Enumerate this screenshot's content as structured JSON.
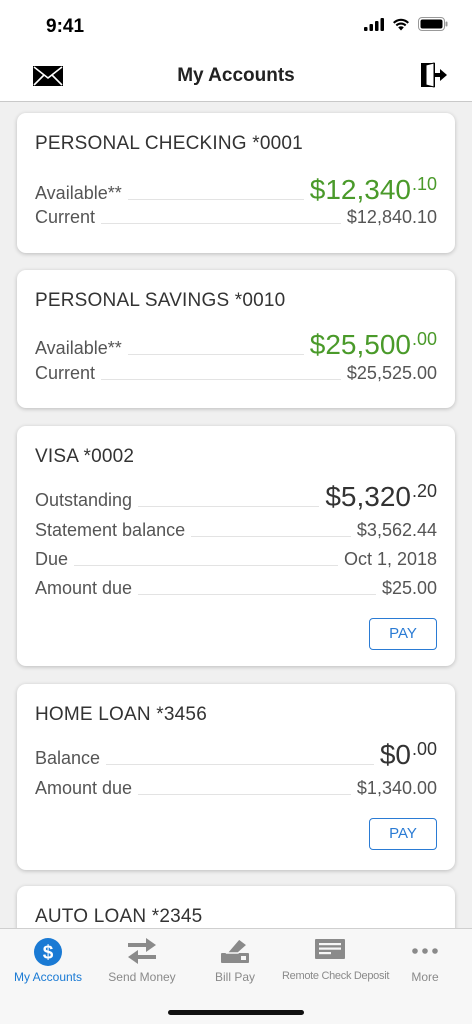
{
  "status_bar": {
    "time": "9:41"
  },
  "header": {
    "title": "My Accounts"
  },
  "accounts": [
    {
      "name": "PERSONAL CHECKING *0001",
      "rows": [
        {
          "label": "Available**",
          "value_main": "$12,340",
          "value_cents": ".10",
          "big": true,
          "color": "#4a9a2a"
        },
        {
          "label": "Current",
          "value": "$12,840.10"
        }
      ]
    },
    {
      "name": "PERSONAL SAVINGS *0010",
      "rows": [
        {
          "label": "Available**",
          "value_main": "$25,500",
          "value_cents": ".00",
          "big": true,
          "color": "#4a9a2a"
        },
        {
          "label": "Current",
          "value": "$25,525.00"
        }
      ]
    },
    {
      "name": "VISA *0002",
      "rows": [
        {
          "label": "Outstanding",
          "value_main": "$5,320",
          "value_cents": ".20",
          "big": true
        },
        {
          "label": "Statement balance",
          "value": "$3,562.44"
        },
        {
          "label": "Due",
          "value": "Oct 1, 2018"
        },
        {
          "label": "Amount due",
          "value": "$25.00"
        }
      ],
      "pay_label": "PAY"
    },
    {
      "name": "HOME LOAN *3456",
      "rows": [
        {
          "label": "Balance",
          "value_main": "$0",
          "value_cents": ".00",
          "big": true
        },
        {
          "label": "Amount due",
          "value": "$1,340.00"
        }
      ],
      "pay_label": "PAY"
    },
    {
      "name": "AUTO LOAN *2345"
    }
  ],
  "tabs": [
    {
      "label": "My Accounts",
      "icon": "dollar-circle-icon",
      "active": true
    },
    {
      "label": "Send Money",
      "icon": "transfer-arrows-icon"
    },
    {
      "label": "Bill Pay",
      "icon": "bill-pay-icon"
    },
    {
      "label": "Remote Check Deposit",
      "icon": "check-deposit-icon"
    },
    {
      "label": "More",
      "icon": "more-dots-icon"
    }
  ],
  "colors": {
    "accent": "#1a7ad4",
    "positive": "#4a9a2a",
    "tab_inactive": "#8a8a8a"
  }
}
